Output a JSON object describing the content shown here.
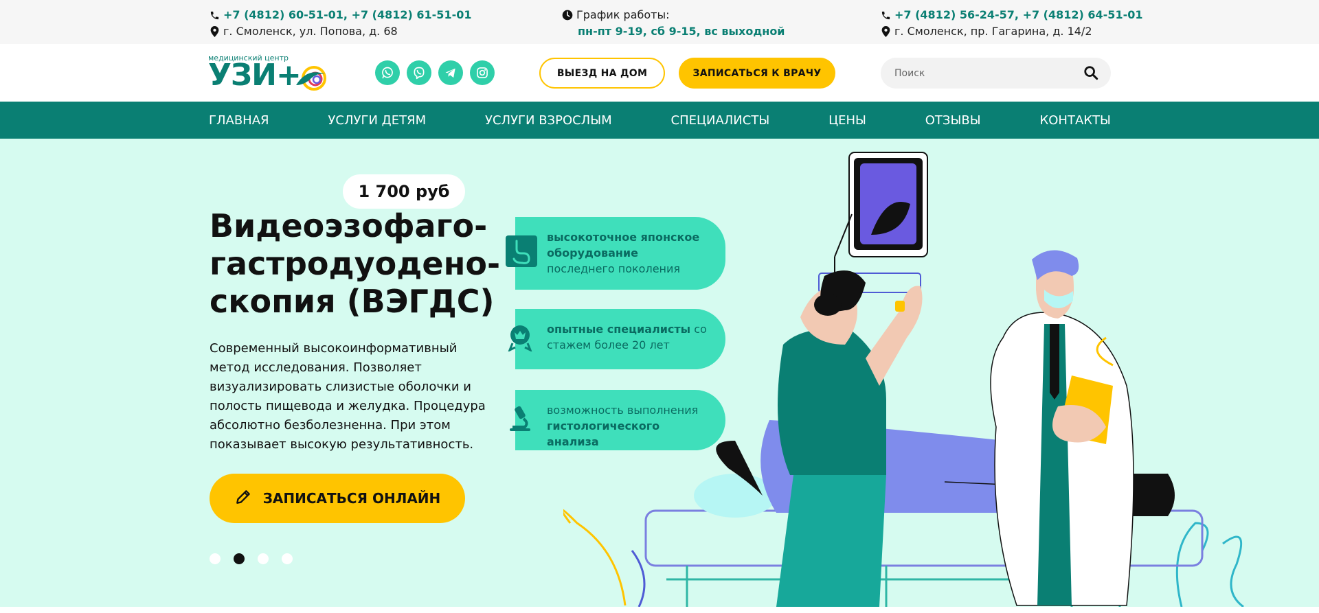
{
  "topbar": {
    "left": {
      "phones": "+7 (4812) 60-51-01, +7 (4812) 61-51-01",
      "address": "г. Смоленск, ул. Попова, д. 68"
    },
    "schedule": {
      "label": "График работы:",
      "value": "пн-пт 9-19, сб 9-15, вс выходной"
    },
    "right": {
      "phones": "+7 (4812) 56-24-57, +7 (4812) 64-51-01",
      "address": "г. Смоленск, пр. Гагарина, д. 14/2"
    }
  },
  "logo": {
    "small": "медицинский центр",
    "big": "УЗИ+"
  },
  "socials": [
    "whatsapp-icon",
    "viber-icon",
    "telegram-icon",
    "instagram-icon"
  ],
  "header": {
    "home_visit_label": "ВЫЕЗД НА ДОМ",
    "book_doctor_label": "ЗАПИСАТЬСЯ К ВРАЧУ",
    "search_placeholder": "Поиск"
  },
  "nav": {
    "items": [
      {
        "label": "ГЛАВНАЯ"
      },
      {
        "label": "УСЛУГИ ДЕТЯМ"
      },
      {
        "label": "УСЛУГИ ВЗРОСЛЫМ"
      },
      {
        "label": "СПЕЦИАЛИСТЫ"
      },
      {
        "label": "ЦЕНЫ"
      },
      {
        "label": "ОТЗЫВЫ"
      },
      {
        "label": "КОНТАКТЫ"
      }
    ]
  },
  "hero": {
    "price": "1 700 руб",
    "title": "Видеоэзофаго-\nгастродуодено-\nскопия (ВЭГДС)",
    "description": "Современный высокоинформативный метод исследования. Позволяет визуализировать слизистые оболочки и полость пищевода и желудка. Процедура абсолютно безболезненна. При этом показывает высокую результативность.",
    "cta_label": "ЗАПИСАТЬСЯ ОНЛАЙН",
    "slides_total": 4,
    "slide_active": 2,
    "features": [
      {
        "bold": "высокоточное японское оборудование",
        "rest": " последнего поколения",
        "icon": "stomach-icon"
      },
      {
        "bold": "опытные специалисты",
        "rest": " со стажем более 20 лет",
        "icon": "award-icon"
      },
      {
        "pre": "возможность выполнения ",
        "bold": "гистологического анализа",
        "icon": "microscope-icon"
      }
    ]
  },
  "colors": {
    "brand": "#0a7f73",
    "accent": "#ffc400",
    "mint": "#3fdfbb",
    "hero_bg": "#d6fbf0"
  }
}
